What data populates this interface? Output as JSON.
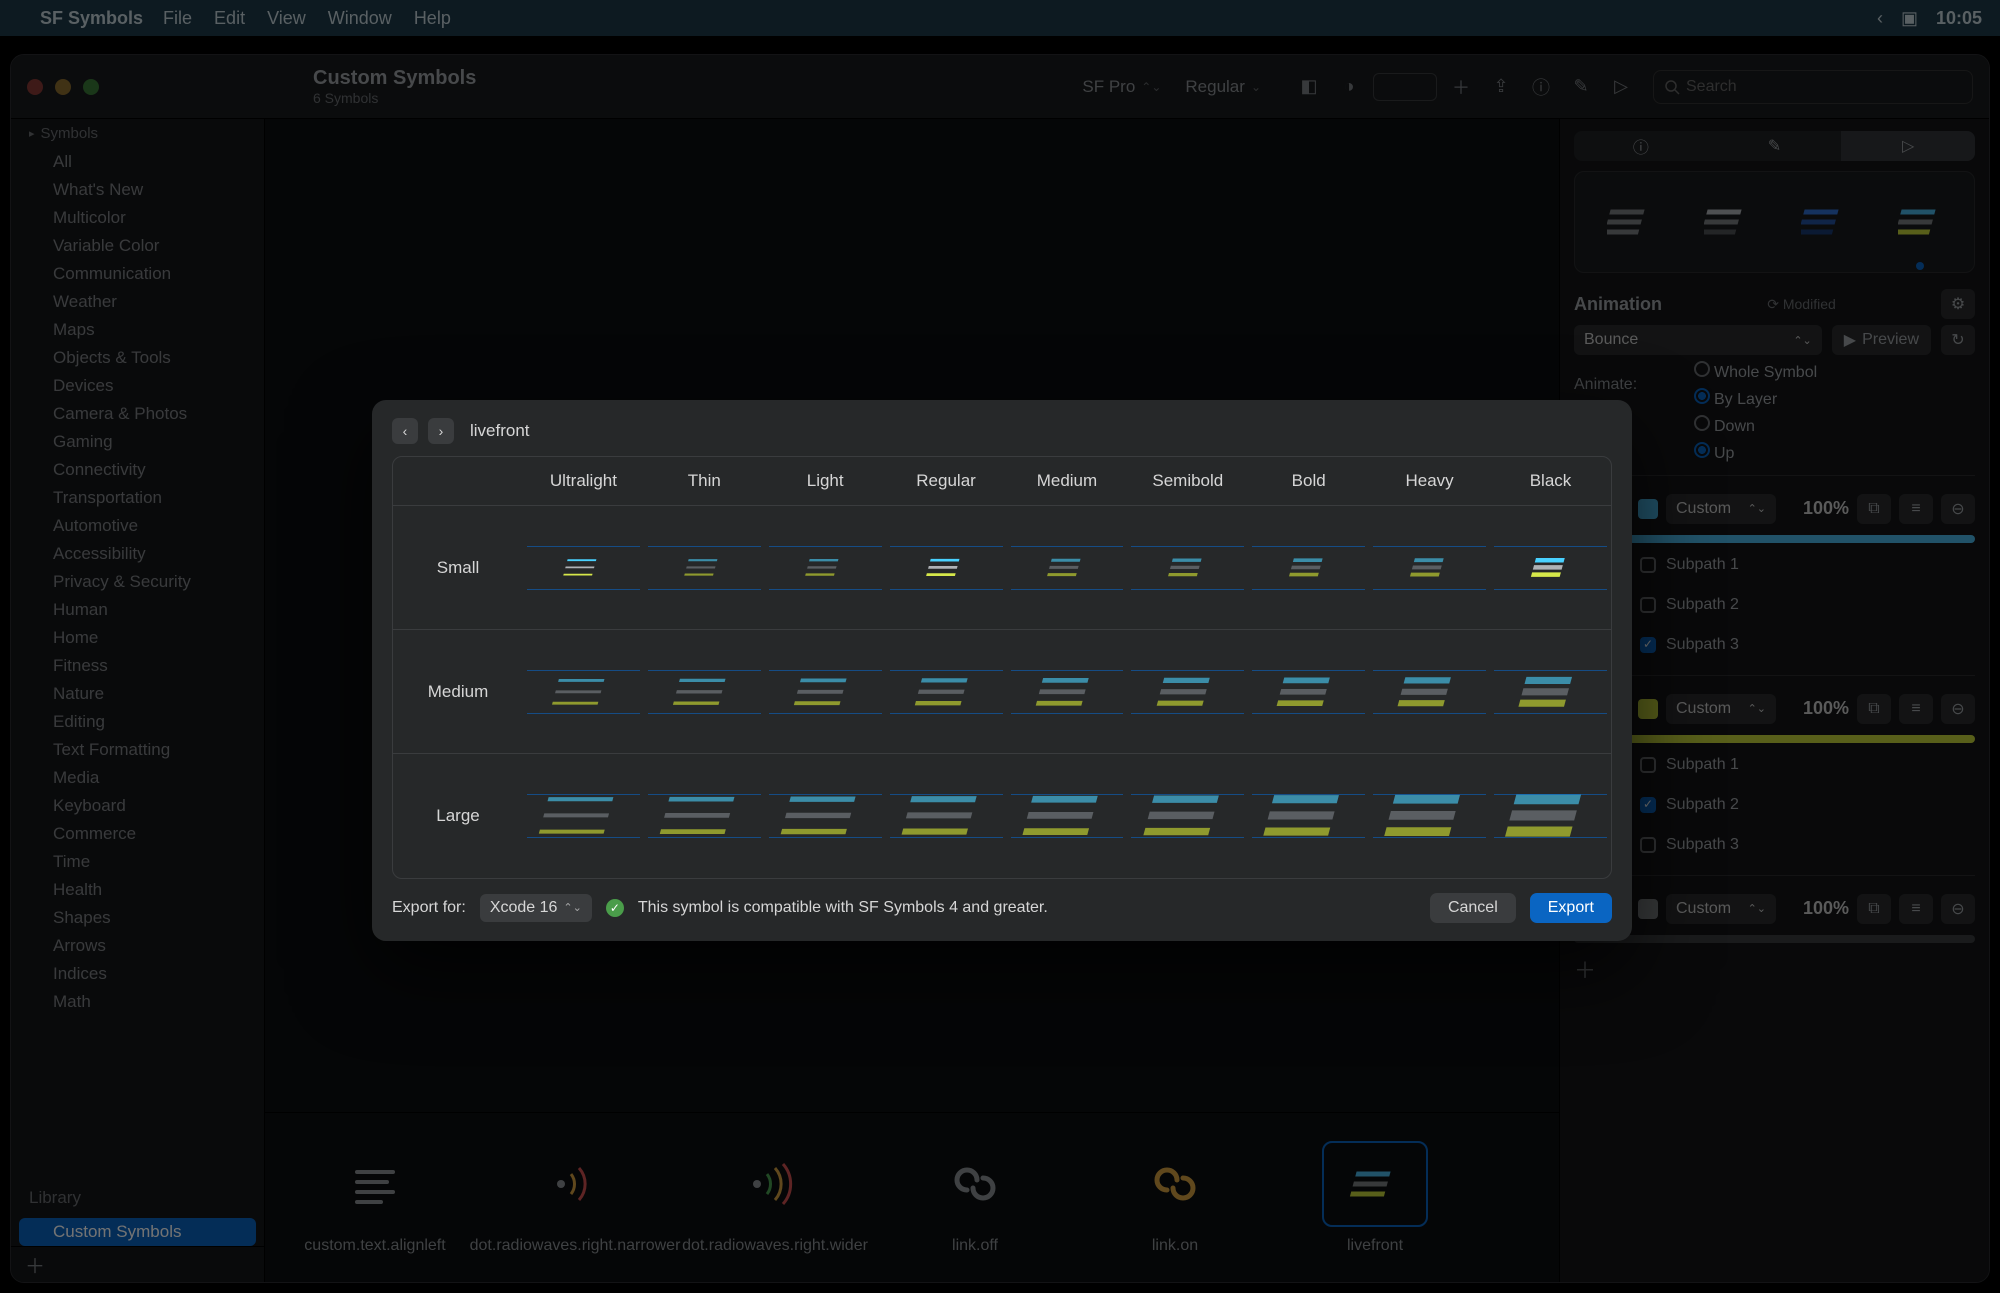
{
  "menubar": {
    "app": "SF Symbols",
    "items": [
      "File",
      "Edit",
      "View",
      "Window",
      "Help"
    ],
    "clock": "10:05"
  },
  "toolbar": {
    "title": "Custom Symbols",
    "subtitle": "6 Symbols",
    "font": "SF Pro",
    "weight": "Regular",
    "search_placeholder": "Search"
  },
  "sidebar": {
    "section1": "Symbols",
    "cats": [
      "All",
      "What's New",
      "Multicolor",
      "Variable Color",
      "Communication",
      "Weather",
      "Maps",
      "Objects & Tools",
      "Devices",
      "Camera & Photos",
      "Gaming",
      "Connectivity",
      "Transportation",
      "Automotive",
      "Accessibility",
      "Privacy & Security",
      "Human",
      "Home",
      "Fitness",
      "Nature",
      "Editing",
      "Text Formatting",
      "Media",
      "Keyboard",
      "Commerce",
      "Time",
      "Health",
      "Shapes",
      "Arrows",
      "Indices",
      "Math"
    ],
    "library_label": "Library",
    "custom_label": "Custom Symbols"
  },
  "strip": [
    {
      "name": "custom.text.alignleft"
    },
    {
      "name": "dot.radiowaves.right.narrower"
    },
    {
      "name": "dot.radiowaves.right.wider"
    },
    {
      "name": "link.off"
    },
    {
      "name": "link.on"
    },
    {
      "name": "livefront"
    }
  ],
  "inspector": {
    "animation_title": "Animation",
    "modified": "Modified",
    "effect": "Bounce",
    "preview": "Preview",
    "animate_label": "Animate:",
    "animate_opts": [
      "Whole Symbol",
      "By Layer"
    ],
    "animate_sel": 1,
    "dir_opts": [
      "Down",
      "Up"
    ],
    "dir_sel": 1,
    "layers": [
      {
        "color_hex": "#49b7e6",
        "color_label": "Custom",
        "opacity": "100%",
        "slider": "cyan",
        "subs": [
          {
            "n": "Subpath 1",
            "on": false
          },
          {
            "n": "Subpath 2",
            "on": false
          },
          {
            "n": "Subpath 3",
            "on": true
          }
        ]
      },
      {
        "color_hex": "#c4d33a",
        "color_label": "Custom",
        "opacity": "100%",
        "slider": "yellow",
        "subs": [
          {
            "n": "Subpath 1",
            "on": false
          },
          {
            "n": "Subpath 2",
            "on": true
          },
          {
            "n": "Subpath 3",
            "on": false
          }
        ]
      },
      {
        "color_hex": "#7a7e82",
        "color_label": "Custom",
        "opacity": "100%",
        "slider": "grey",
        "subs": []
      }
    ]
  },
  "modal": {
    "title": "livefront",
    "weights": [
      "Ultralight",
      "Thin",
      "Light",
      "Regular",
      "Medium",
      "Semibold",
      "Bold",
      "Heavy",
      "Black"
    ],
    "sizes": [
      "Small",
      "Medium",
      "Large"
    ],
    "export_for_label": "Export for:",
    "export_target": "Xcode 16",
    "compat": "This symbol is compatible with SF Symbols 4 and greater.",
    "cancel": "Cancel",
    "export": "Export"
  }
}
